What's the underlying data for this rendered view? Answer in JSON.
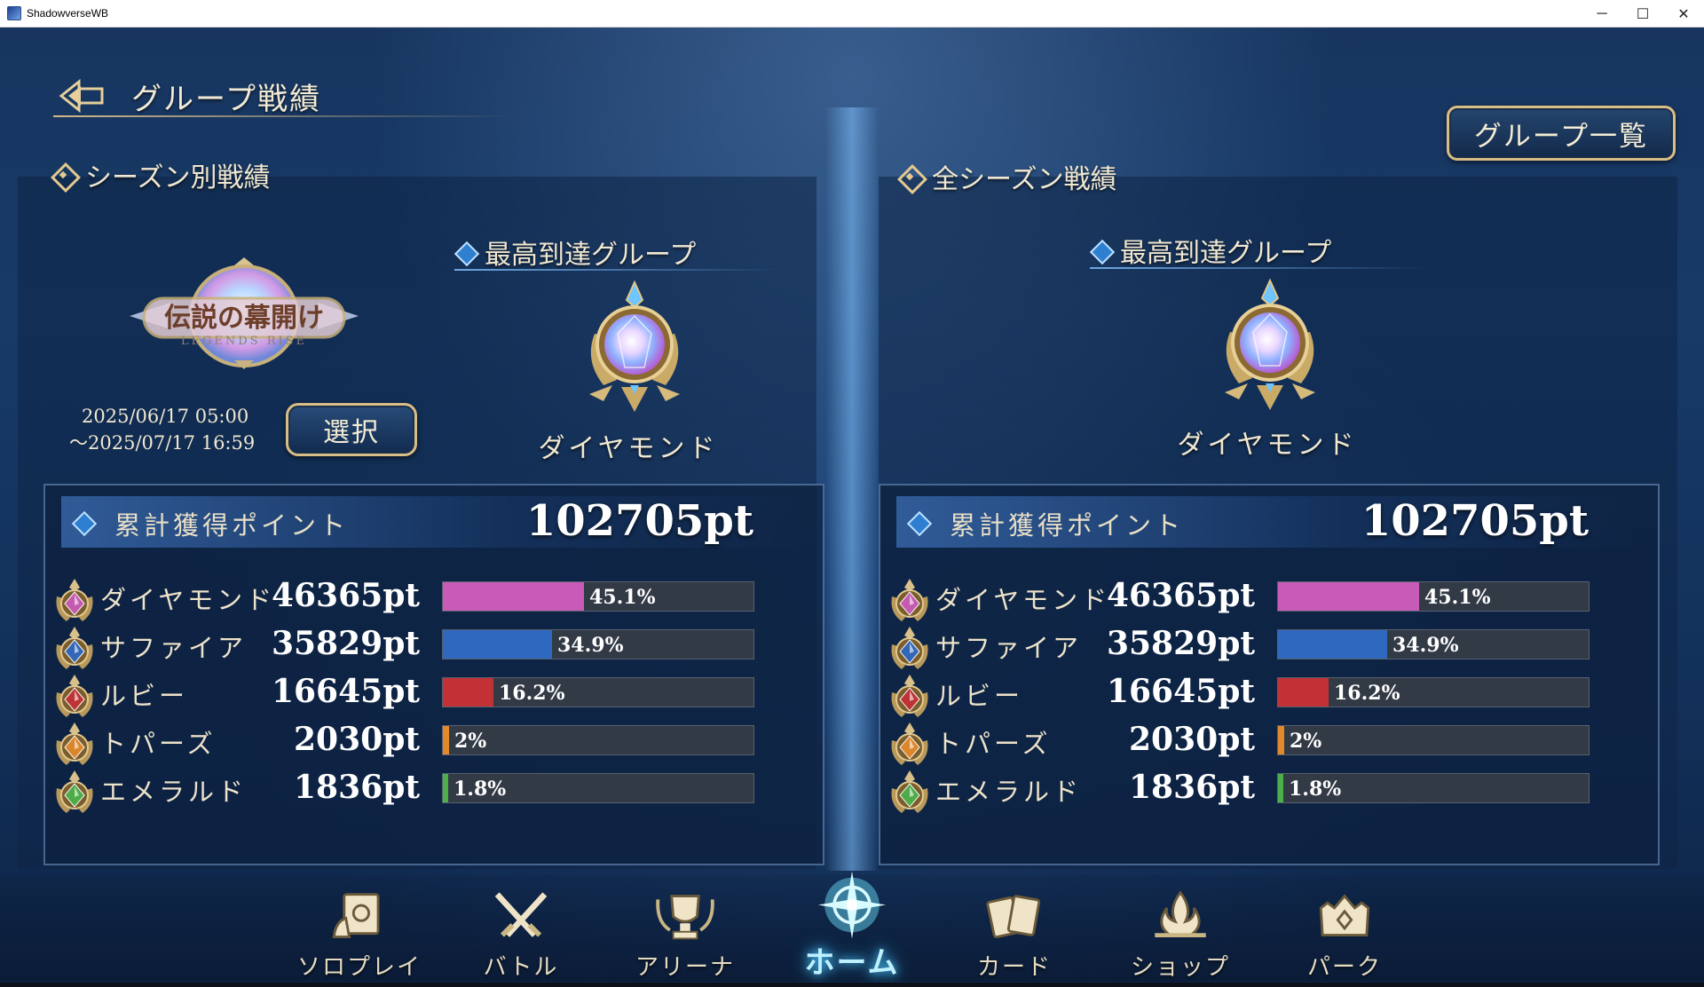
{
  "window": {
    "title": "ShadowverseWB",
    "minimize": "─",
    "maximize": "☐",
    "close": "✕"
  },
  "header": {
    "title": "グループ戦績",
    "group_list_button": "グループ一覧"
  },
  "season_panel": {
    "section_title": "シーズン別戦績",
    "season_logo_text": "伝説の幕開け",
    "season_logo_subtext": "LEGENDS RISE",
    "date_start": "2025/06/17 05:00",
    "date_end": "～2025/07/17 16:59",
    "select_button": "選択",
    "highest_group_label": "最高到達グループ",
    "highest_group_name": "ダイヤモンド",
    "points_label": "累計獲得ポイント",
    "points_total": "102705pt",
    "ranks": [
      {
        "name": "ダイヤモンド",
        "points": "46365pt",
        "percent_label": "45.1%",
        "fraction": 0.451,
        "color": "#c95bb8",
        "icon": "diamond-gem-icon"
      },
      {
        "name": "サファイア",
        "points": "35829pt",
        "percent_label": "34.9%",
        "fraction": 0.349,
        "color": "#2f68bf",
        "icon": "sapphire-gem-icon"
      },
      {
        "name": "ルビー",
        "points": "16645pt",
        "percent_label": "16.2%",
        "fraction": 0.162,
        "color": "#c23136",
        "icon": "ruby-gem-icon"
      },
      {
        "name": "トパーズ",
        "points": "2030pt",
        "percent_label": "2%",
        "fraction": 0.02,
        "color": "#e2892b",
        "icon": "topaz-gem-icon"
      },
      {
        "name": "エメラルド",
        "points": "1836pt",
        "percent_label": "1.8%",
        "fraction": 0.018,
        "color": "#4bb04a",
        "icon": "emerald-gem-icon"
      }
    ]
  },
  "all_panel": {
    "section_title": "全シーズン戦績",
    "highest_group_label": "最高到達グループ",
    "highest_group_name": "ダイヤモンド",
    "points_label": "累計獲得ポイント",
    "points_total": "102705pt",
    "ranks": [
      {
        "name": "ダイヤモンド",
        "points": "46365pt",
        "percent_label": "45.1%",
        "fraction": 0.451,
        "color": "#c95bb8",
        "icon": "diamond-gem-icon"
      },
      {
        "name": "サファイア",
        "points": "35829pt",
        "percent_label": "34.9%",
        "fraction": 0.349,
        "color": "#2f68bf",
        "icon": "sapphire-gem-icon"
      },
      {
        "name": "ルビー",
        "points": "16645pt",
        "percent_label": "16.2%",
        "fraction": 0.162,
        "color": "#c23136",
        "icon": "ruby-gem-icon"
      },
      {
        "name": "トパーズ",
        "points": "2030pt",
        "percent_label": "2%",
        "fraction": 0.02,
        "color": "#e2892b",
        "icon": "topaz-gem-icon"
      },
      {
        "name": "エメラルド",
        "points": "1836pt",
        "percent_label": "1.8%",
        "fraction": 0.018,
        "color": "#4bb04a",
        "icon": "emerald-gem-icon"
      }
    ]
  },
  "nav": {
    "items": [
      {
        "label": "ソロプレイ",
        "icon": "solo-play-icon"
      },
      {
        "label": "バトル",
        "icon": "crossed-swords-icon"
      },
      {
        "label": "アリーナ",
        "icon": "trophy-icon"
      },
      {
        "label": "ホーム",
        "icon": "home-emblem-icon",
        "active": true
      },
      {
        "label": "カード",
        "icon": "cards-icon"
      },
      {
        "label": "ショップ",
        "icon": "shop-flame-icon"
      },
      {
        "label": "パーク",
        "icon": "park-castle-icon"
      }
    ]
  },
  "colors": {
    "gold": "#d9bd86",
    "text": "#f1e8d1",
    "active_glow": "#47c5ff",
    "bar_track": "#323a46"
  }
}
